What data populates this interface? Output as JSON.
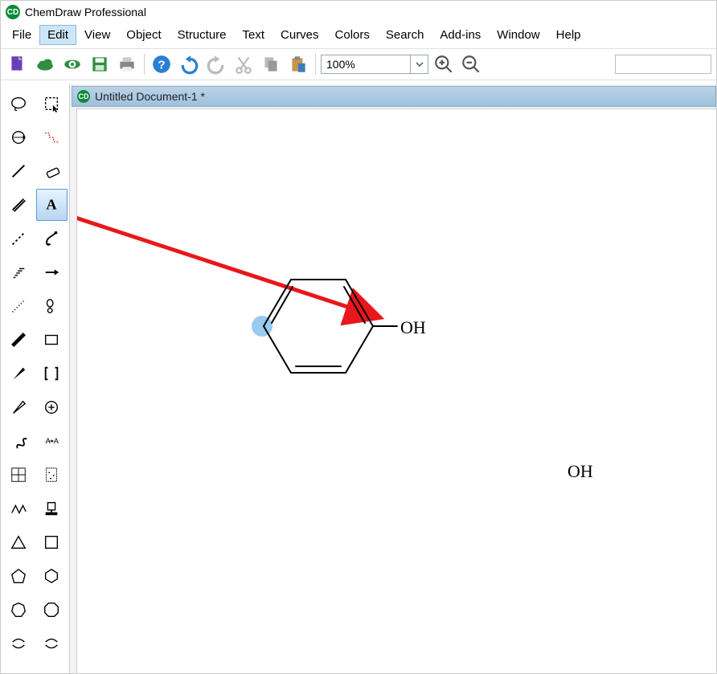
{
  "app": {
    "title": "ChemDraw Professional"
  },
  "menu": {
    "items": [
      "File",
      "Edit",
      "View",
      "Object",
      "Structure",
      "Text",
      "Curves",
      "Colors",
      "Search",
      "Add-ins",
      "Window",
      "Help"
    ],
    "active_index": 1
  },
  "toolbar": {
    "zoom_value": "100%"
  },
  "document": {
    "title": "Untitled Document-1 *"
  },
  "molecule": {
    "label_oh": "OH"
  },
  "palette_tools": [
    "lasso",
    "marquee",
    "rotate-3d",
    "fragment",
    "single-bond",
    "eraser",
    "double-bond",
    "text",
    "dashed-bond",
    "pen",
    "hash-bond",
    "arrow",
    "dot-bond",
    "retro-arrow",
    "bold-bond",
    "box",
    "wedge",
    "brackets",
    "hollow-wedge",
    "add-atom",
    "wavy-bond",
    "map-atoms",
    "table",
    "tlc",
    "chain",
    "stamp",
    "triangle",
    "rectangle",
    "pentagon",
    "hexagon",
    "heptagon",
    "octagon",
    "smiles-left",
    "smiles-right"
  ],
  "palette_selected_index": 7,
  "icon_glyph": {
    "app": "CD",
    "doc": "CD"
  }
}
